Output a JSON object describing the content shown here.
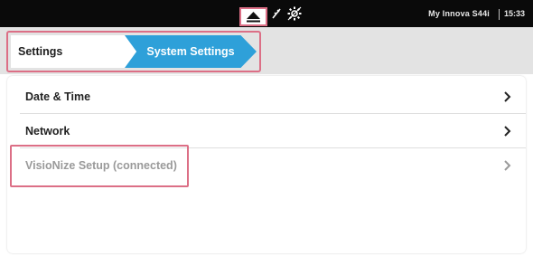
{
  "status_bar": {
    "device_name": "My Innova S44i",
    "time": "15:33",
    "icons": [
      "eject-icon",
      "usb-icon",
      "settings-gear-icon"
    ]
  },
  "breadcrumb": {
    "items": [
      {
        "label": "Settings"
      },
      {
        "label": "System Settings"
      }
    ],
    "active_color": "#2ea0d9"
  },
  "menu": {
    "items": [
      {
        "label": "Date & Time",
        "enabled": true
      },
      {
        "label": "Network",
        "enabled": true
      },
      {
        "label": "VisioNize Setup (connected)",
        "enabled": false
      }
    ]
  },
  "colors": {
    "highlight": "#dc6f86",
    "status_bar": "#0a0a0a",
    "accent": "#2ea0d9"
  }
}
